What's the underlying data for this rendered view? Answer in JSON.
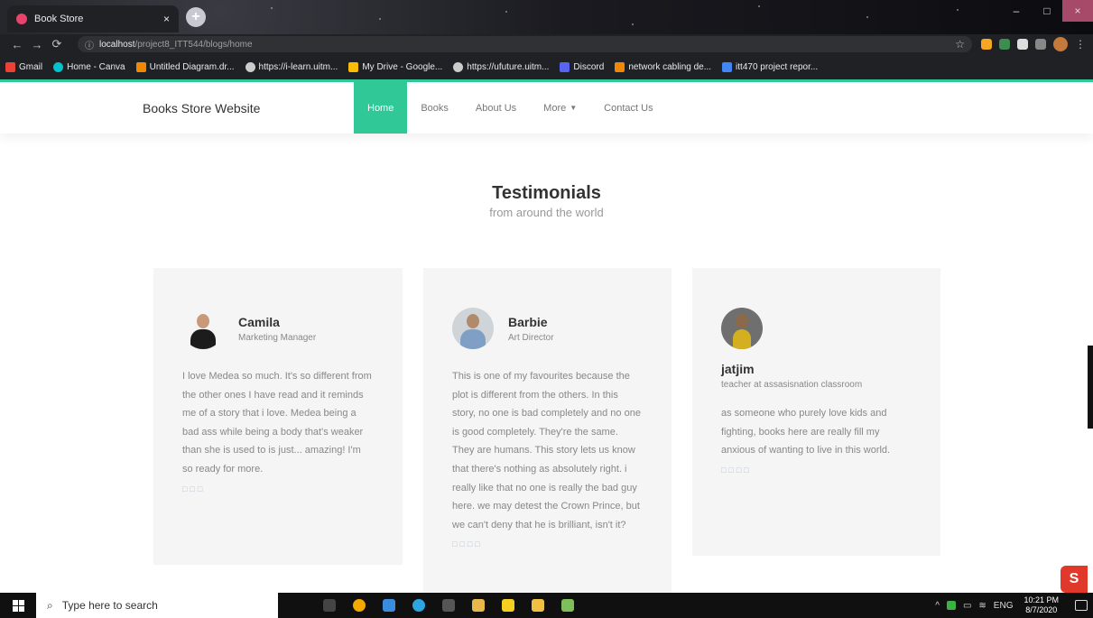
{
  "browser": {
    "tab_title": "Book Store",
    "tab_close": "×",
    "new_tab": "+",
    "url_host": "localhost",
    "url_path": "/project8_ITT544/blogs/home",
    "win_minimize": "–",
    "win_maximize": "□",
    "win_close": "×",
    "bookmarks": [
      {
        "label": "Gmail",
        "icon_color": "#ea4335"
      },
      {
        "label": "Home - Canva",
        "icon_color": "#00c4cc"
      },
      {
        "label": "Untitled Diagram.dr...",
        "icon_color": "#f08705"
      },
      {
        "label": "https://i-learn.uitm...",
        "icon_color": "#cccccc"
      },
      {
        "label": "My Drive - Google...",
        "icon_color": "#fbbc04"
      },
      {
        "label": "https://ufuture.uitm...",
        "icon_color": "#cccccc"
      },
      {
        "label": "Discord",
        "icon_color": "#5865f2"
      },
      {
        "label": "network cabling de...",
        "icon_color": "#f08705"
      },
      {
        "label": "itt470 project repor...",
        "icon_color": "#4285f4"
      }
    ]
  },
  "site": {
    "brand": "Books Store Website",
    "nav": {
      "home": "Home",
      "books": "Books",
      "about": "About Us",
      "more": "More",
      "contact": "Contact Us"
    }
  },
  "testimonials": {
    "title": "Testimonials",
    "subtitle": "from around the world",
    "items": [
      {
        "name": "Camila",
        "role": "Marketing Manager",
        "quote": "I love Medea so much. It's so different from the other ones I have read and it reminds me of a story that i love. Medea being a bad ass while being a body that's weaker than she is used to is just... amazing! I'm so ready for more.",
        "stars": "□□□"
      },
      {
        "name": "Barbie",
        "role": "Art Director",
        "quote": "This is one of my favourites because the plot is different from the others. In this story, no one is bad completely and no one is good completely. They're the same. They are humans. This story lets us know that there's nothing as absolutely right. i really like that no one is really the bad guy here. we may detest the Crown Prince, but we can't deny that he is brilliant, isn't it?",
        "stars": "□□□□"
      },
      {
        "name": "jatjim",
        "role": "teacher at assasisnation classroom",
        "quote": "as someone who purely love kids and fighting, books here are really fill my anxious of wanting to live in this world.",
        "stars": "□□□□"
      }
    ]
  },
  "taskbar": {
    "search_placeholder": "Type here to search",
    "lang": "ENG",
    "time": "10:21 PM",
    "date": "8/7/2020"
  },
  "colors": {
    "accent": "#2fc896",
    "card_bg": "#f5f5f5"
  }
}
